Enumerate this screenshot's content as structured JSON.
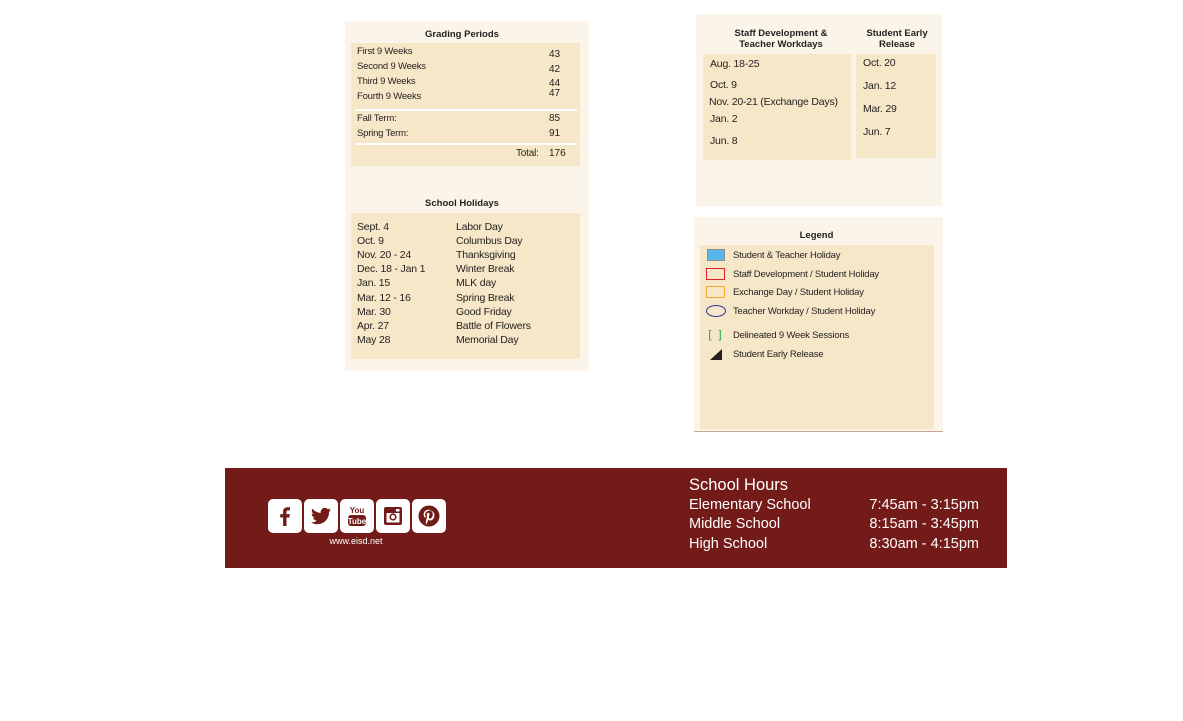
{
  "grading_periods": {
    "title": "Grading Periods",
    "periods": [
      {
        "label": "First 9 Weeks",
        "days": "43"
      },
      {
        "label": "Second 9 Weeks",
        "days": "42"
      },
      {
        "label": "Third 9 Weeks",
        "days": "44"
      },
      {
        "label": "Fourth 9 Weeks",
        "days": "47"
      }
    ],
    "terms": [
      {
        "label": "Fall Term:",
        "days": "85"
      },
      {
        "label": "Spring Term:",
        "days": "91"
      }
    ],
    "total_label": "Total:",
    "total_value": "176"
  },
  "school_holidays": {
    "title": "School Holidays",
    "items": [
      {
        "date": "Sept. 4",
        "name": "Labor Day"
      },
      {
        "date": "Oct. 9",
        "name": "Columbus Day"
      },
      {
        "date": "Nov. 20 - 24",
        "name": "Thanksgiving"
      },
      {
        "date": "Dec. 18 - Jan 1",
        "name": "Winter Break"
      },
      {
        "date": "Jan. 15",
        "name": "MLK day"
      },
      {
        "date": "Mar. 12 - 16",
        "name": "Spring Break"
      },
      {
        "date": "Mar. 30",
        "name": "Good Friday"
      },
      {
        "date": "Apr. 27",
        "name": "Battle of Flowers"
      },
      {
        "date": "May 28",
        "name": "Memorial Day"
      }
    ]
  },
  "staff_development": {
    "title_line1": "Staff Development &",
    "title_line2": "Teacher Workdays",
    "items": [
      "Aug. 18-25",
      "Oct. 9",
      "Nov. 20-21 (Exchange Days)",
      "Jan. 2",
      "Jun. 8"
    ]
  },
  "early_release": {
    "title_line1": "Student Early",
    "title_line2": "Release",
    "items": [
      "Oct. 20",
      "Jan. 12",
      "Mar. 29",
      "Jun. 7"
    ]
  },
  "legend": {
    "title": "Legend",
    "items": [
      {
        "symbol": "blue-filled-square",
        "label": "Student & Teacher Holiday",
        "color": "#58b5e8"
      },
      {
        "symbol": "red-outline-square",
        "label": "Staff Development / Student Holiday",
        "color": "#e21f26"
      },
      {
        "symbol": "orange-outline-square",
        "label": "Exchange Day / Student Holiday",
        "color": "#f7a937"
      },
      {
        "symbol": "navy-oval",
        "label": "Teacher Workday / Student Holiday",
        "color": "#2e3192"
      },
      {
        "symbol": "green-brackets",
        "glyph": "[ ]",
        "label": "Delineated 9 Week Sessions",
        "color": "#1aa14b"
      },
      {
        "symbol": "black-triangle",
        "label": "Student Early Release",
        "color": "#231f20"
      }
    ]
  },
  "footer": {
    "background": "#731b18",
    "social": [
      "facebook",
      "twitter",
      "youtube",
      "instagram",
      "pinterest"
    ],
    "youtube_text_top": "You",
    "youtube_text_bottom": "Tube",
    "url": "www.eisd.net",
    "hours_title": "School Hours",
    "hours": [
      {
        "school": "Elementary School",
        "time": "7:45am - 3:15pm"
      },
      {
        "school": "Middle School",
        "time": "8:15am - 3:45pm"
      },
      {
        "school": "High School",
        "time": "8:30am - 4:15pm"
      }
    ]
  }
}
